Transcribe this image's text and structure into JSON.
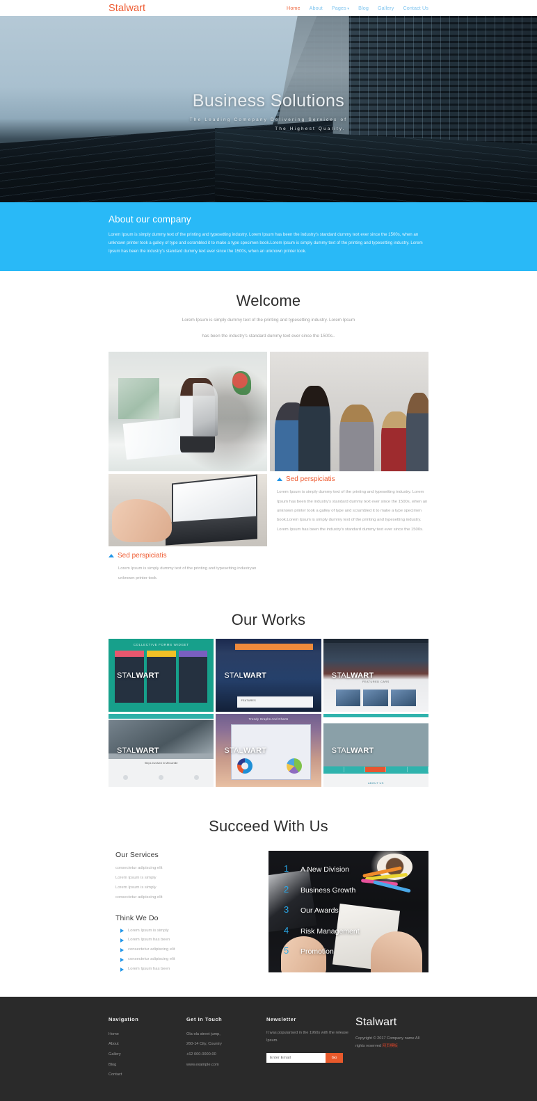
{
  "header": {
    "brand": "Stalwart",
    "nav": [
      {
        "label": "Home",
        "active": true
      },
      {
        "label": "About",
        "active": false
      },
      {
        "label": "Pages",
        "active": false,
        "caret": "▾"
      },
      {
        "label": "Blog",
        "active": false
      },
      {
        "label": "Gallery",
        "active": false
      },
      {
        "label": "Contact Us",
        "active": false
      }
    ]
  },
  "hero": {
    "title": "Business Solutions",
    "subtitle_line1": "The Leading Comepany Delivering Services of",
    "subtitle_line2": "The Highest Quality."
  },
  "about": {
    "title": "About our company",
    "text": "Lorem Ipsum is simply dummy text of the printing and typesetting industry. Lorem Ipsum has been the industry's standard dummy text ever since the 1500s, when an unknown printer took a galley of type and scrambled it to make a type specimen book.Lorem Ipsum is simply dummy text of the printing and typesetting industry. Lorem Ipsum has been the industry's standard dummy text ever since the 1500s, when an unknown printer took."
  },
  "welcome": {
    "title": "Welcome",
    "subtitle_line1": "Lorem Ipsum is simply dummy text of the printing and typesetting industry. Lorem Ipsum",
    "subtitle_line2": "has been the industry's standard dummy text ever since the 1500s..",
    "block_right": {
      "heading": "Sed perspiciatis",
      "text": "Lorem Ipsum is simply dummy text of the printing and typesetting industry. Lorem Ipsum has been the industry's standard dummy text ever since the 1500s, when an unknown printer took a galley of type and scrambled it to make a type specimen book.Lorem Ipsum is simply dummy text of the printing and typesetting industry. Lorem Ipsum has been the industry's standard dummy text ever since the 1500s."
    },
    "block_bottom": {
      "heading": "Sed perspiciatis",
      "text": "Lorem Ipsum is simply dummy text of the printing and typesetting industryan unknown printer took."
    }
  },
  "works": {
    "title": "Our Works",
    "items": [
      {
        "overlay_prefix": "STAL",
        "overlay_suffix": "WART",
        "caption": "COLLECTIVE FORMS WIDGET"
      },
      {
        "overlay_prefix": "STAL",
        "overlay_suffix": "WART",
        "caption": "FEATURES"
      },
      {
        "overlay_prefix": "STAL",
        "overlay_suffix": "WART",
        "caption": "FEATURED CARS"
      },
      {
        "overlay_prefix": "STAL",
        "overlay_suffix": "WART",
        "caption": "Steps Involved In Mercantile"
      },
      {
        "overlay_prefix": "STAL",
        "overlay_suffix": "WART",
        "caption": "Trendy Graphs And Charts"
      },
      {
        "overlay_prefix": "STAL",
        "overlay_suffix": "WART",
        "caption": "ABOUT US"
      }
    ]
  },
  "succeed": {
    "title": "Succeed With Us",
    "services_heading": "Our Services",
    "services": [
      "consectetur adipiscing elit",
      "Lorem Ipsum is simply",
      "Lorem Ipsum is simply",
      "consectetur adipiscing elit"
    ],
    "think_heading": "Think We Do",
    "think": [
      "Lorem Ipsum is simply",
      "Lorem Ipsum has been",
      "consectetur adipiscing elit",
      "consectetur adipiscing elit",
      "Lorem Ipsum has been"
    ],
    "steps": [
      {
        "num": "1",
        "label": "A New Division"
      },
      {
        "num": "2",
        "label": "Business Growth"
      },
      {
        "num": "3",
        "label": "Our Awards"
      },
      {
        "num": "4",
        "label": "Risk Management"
      },
      {
        "num": "5",
        "label": "Promotion"
      }
    ]
  },
  "footer": {
    "nav_heading": "Navigation",
    "nav_links": [
      "Home",
      "About",
      "Gallery",
      "Blog",
      "Contact"
    ],
    "touch_heading": "Get In Touch",
    "touch_lines": [
      "Ola-ola street jump,",
      "260-14 City, Country",
      "+62 000-0000-00",
      "www.example.com"
    ],
    "newsletter_heading": "Newsletter",
    "newsletter_text": "It was popularised in the 1960s with the release Ipsum.",
    "newsletter_placeholder": "Enter Email",
    "newsletter_value": "",
    "newsletter_button": "Go",
    "brand": "Stalwart",
    "copyright": "Copyright © 2017 Company name All rights reserved ",
    "copyright_cn": "网页模板"
  },
  "colors": {
    "accent_orange": "#ee5b31",
    "accent_blue": "#29b9f7",
    "nav_blue": "#7ec4ef",
    "footer_bg": "#2a2a2a",
    "step_blue": "#29a8e8"
  }
}
